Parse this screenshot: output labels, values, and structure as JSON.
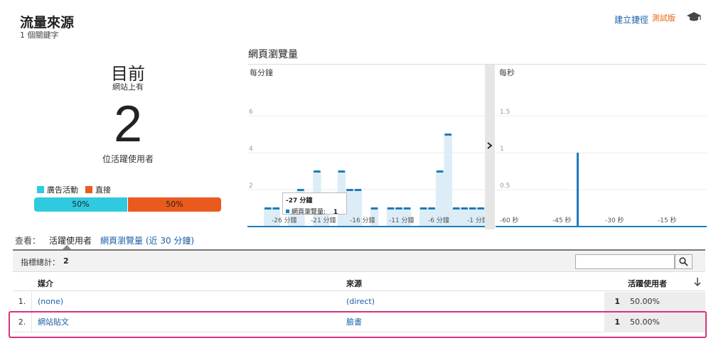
{
  "header": {
    "title": "流量來源",
    "subtitle": "1 個關鍵字",
    "create_shortcut": "建立捷徑",
    "beta": "測試版",
    "cap_icon": "graduation-cap-icon"
  },
  "realtime": {
    "heading": "目前",
    "sub": "網站上有",
    "count": "2",
    "unit": "位活躍使用者",
    "legend": [
      {
        "label": "廣告活動",
        "color": "#2fc9e0"
      },
      {
        "label": "直接",
        "color": "#ea5a1d"
      }
    ],
    "split": [
      {
        "label": "50%",
        "color": "#2fc9e0"
      },
      {
        "label": "50%",
        "color": "#ea5a1d"
      }
    ]
  },
  "chart": {
    "title": "網頁瀏覽量",
    "per_minute_label": "每分鐘",
    "per_second_label": "每秒",
    "expand_icon": "chevron-right-icon"
  },
  "chart_data": [
    {
      "type": "bar",
      "title": "每分鐘",
      "y_ticks": [
        "2",
        "4",
        "6"
      ],
      "ylim": [
        0,
        8
      ],
      "x_tick_labels": [
        "-26 分鐘",
        "-21 分鐘",
        "-16 分鐘",
        "-11 分鐘",
        "-6 分鐘",
        "-1 分鐘"
      ],
      "x": [
        -29,
        -28,
        -27,
        -26,
        -25,
        -24,
        -23,
        -22,
        -21,
        -20,
        -19,
        -18,
        -17,
        -16,
        -15,
        -14,
        -13,
        -12,
        -11,
        -10,
        -9,
        -8,
        -7,
        -6,
        -5,
        -4,
        -3,
        -2,
        -1
      ],
      "values": [
        0,
        0,
        1,
        1,
        0,
        1,
        2,
        0,
        3,
        1,
        0,
        3,
        2,
        2,
        0,
        1,
        0,
        1,
        1,
        1,
        0,
        1,
        1,
        3,
        5,
        1,
        1,
        1,
        1
      ],
      "color": "#1d7cb8"
    },
    {
      "type": "bar",
      "title": "每秒",
      "y_ticks": [
        "0.5",
        "1",
        "1.5"
      ],
      "ylim": [
        0,
        2
      ],
      "x_tick_labels": [
        "-60 秒",
        "-45 秒",
        "-30 秒",
        "-15 秒"
      ],
      "x": [
        -60,
        -45,
        -30,
        -15
      ],
      "values": [
        0,
        1,
        0,
        0
      ],
      "color": "#1d7cb8"
    }
  ],
  "tooltip": {
    "title": "-27 分鐘",
    "series": "網頁瀏覽量:",
    "value": "1"
  },
  "view": {
    "label": "查看：",
    "active_tab": "活躍使用者",
    "other_tab": "網頁瀏覽量 (近 30 分鐘)"
  },
  "table": {
    "totals_label": "指標總計：",
    "totals_value": "2",
    "search_placeholder": "",
    "columns": [
      "媒介",
      "來源",
      "活躍使用者"
    ],
    "rows": [
      {
        "idx": "1.",
        "medium": "(none)",
        "source": "(direct)",
        "value": "1",
        "pct": "50.00%"
      },
      {
        "idx": "2.",
        "medium": "網站貼文",
        "source": "臉書",
        "value": "1",
        "pct": "50.00%"
      }
    ]
  }
}
